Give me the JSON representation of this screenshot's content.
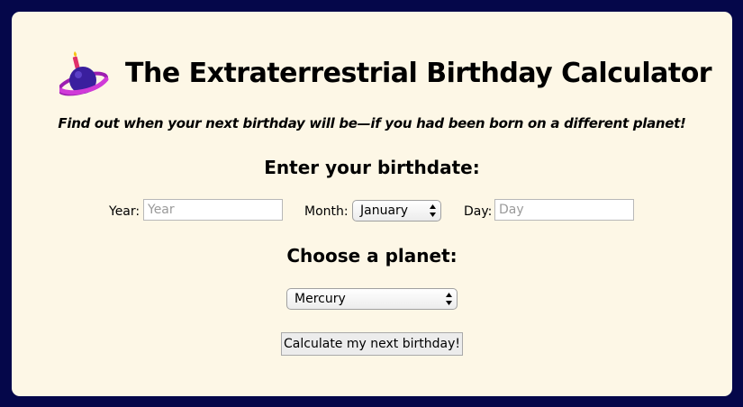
{
  "header": {
    "title": "The Extraterrestrial Birthday Calculator",
    "subtitle": "Find out when your next birthday will be—if you had been born on a different planet!",
    "logo_icon": "planet-with-candle-icon"
  },
  "birthdate": {
    "heading": "Enter your birthdate:",
    "year_label": "Year:",
    "year_placeholder": "Year",
    "year_value": "",
    "month_label": "Month:",
    "month_selected": "January",
    "day_label": "Day:",
    "day_placeholder": "Day",
    "day_value": ""
  },
  "planet": {
    "heading": "Choose a planet:",
    "selected": "Mercury"
  },
  "actions": {
    "calculate_label": "Calculate my next birthday!"
  },
  "colors": {
    "page_background": "#05074a",
    "card_background": "#fdf7e6",
    "planet_body": "#3a1f9e",
    "planet_ring": "#d03ad8",
    "candle": "#e0306a",
    "flame": "#f6c417"
  }
}
